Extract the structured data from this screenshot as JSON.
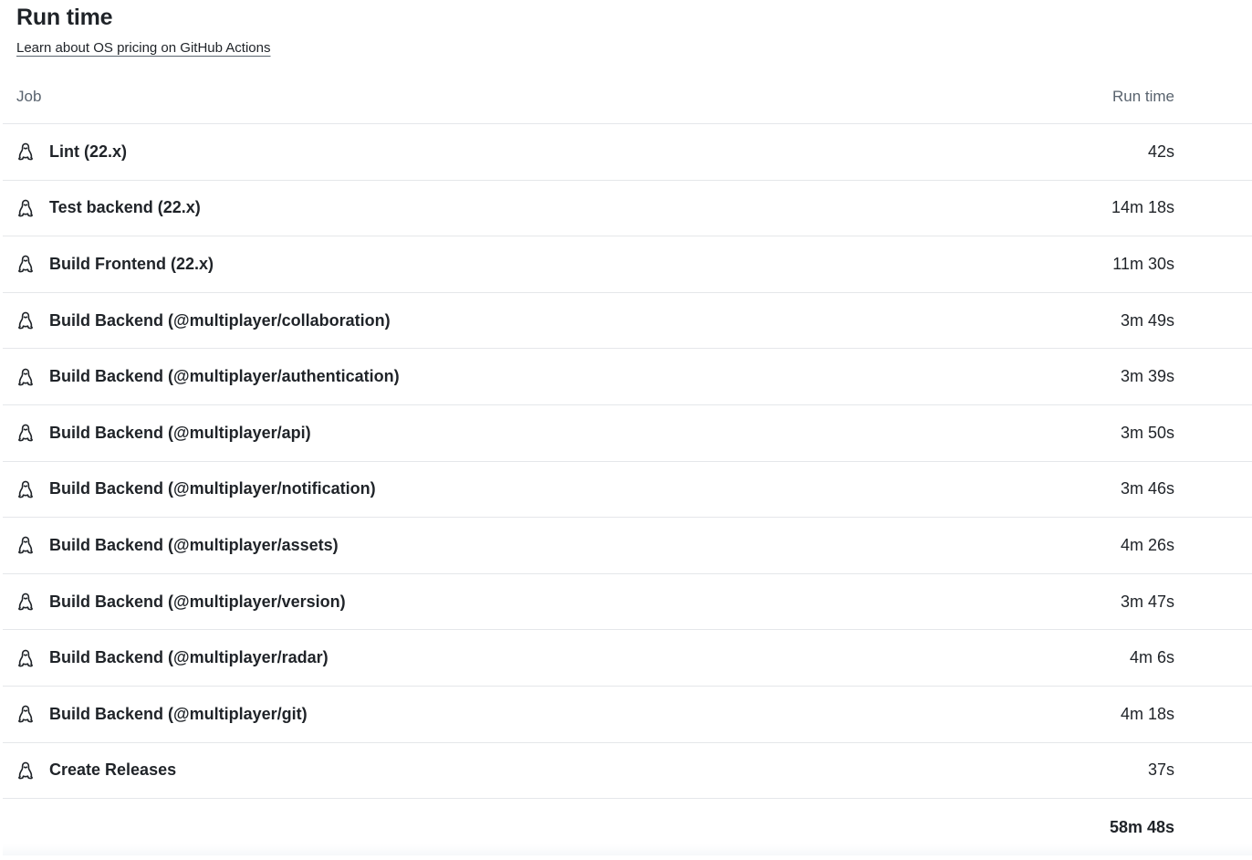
{
  "header": {
    "title": "Run time",
    "link_label": "Learn about OS pricing on GitHub Actions"
  },
  "table": {
    "columns": [
      "Job",
      "Run time"
    ],
    "rows": [
      {
        "os_icon": "linux-penguin-icon",
        "job": "Lint (22.x)",
        "time": "42s"
      },
      {
        "os_icon": "linux-penguin-icon",
        "job": "Test backend (22.x)",
        "time": "14m 18s"
      },
      {
        "os_icon": "linux-penguin-icon",
        "job": "Build Frontend (22.x)",
        "time": "11m 30s"
      },
      {
        "os_icon": "linux-penguin-icon",
        "job": "Build Backend (@multiplayer/collaboration)",
        "time": "3m 49s"
      },
      {
        "os_icon": "linux-penguin-icon",
        "job": "Build Backend (@multiplayer/authentication)",
        "time": "3m 39s"
      },
      {
        "os_icon": "linux-penguin-icon",
        "job": "Build Backend (@multiplayer/api)",
        "time": "3m 50s"
      },
      {
        "os_icon": "linux-penguin-icon",
        "job": "Build Backend (@multiplayer/notification)",
        "time": "3m 46s"
      },
      {
        "os_icon": "linux-penguin-icon",
        "job": "Build Backend (@multiplayer/assets)",
        "time": "4m 26s"
      },
      {
        "os_icon": "linux-penguin-icon",
        "job": "Build Backend (@multiplayer/version)",
        "time": "3m 47s"
      },
      {
        "os_icon": "linux-penguin-icon",
        "job": "Build Backend (@multiplayer/radar)",
        "time": "4m 6s"
      },
      {
        "os_icon": "linux-penguin-icon",
        "job": "Build Backend (@multiplayer/git)",
        "time": "4m 18s"
      },
      {
        "os_icon": "linux-penguin-icon",
        "job": "Create Releases",
        "time": "37s"
      }
    ],
    "total": "58m 48s"
  },
  "colors": {
    "text": "#1f2328",
    "muted": "#59636e",
    "border": "#e5e7ea"
  }
}
